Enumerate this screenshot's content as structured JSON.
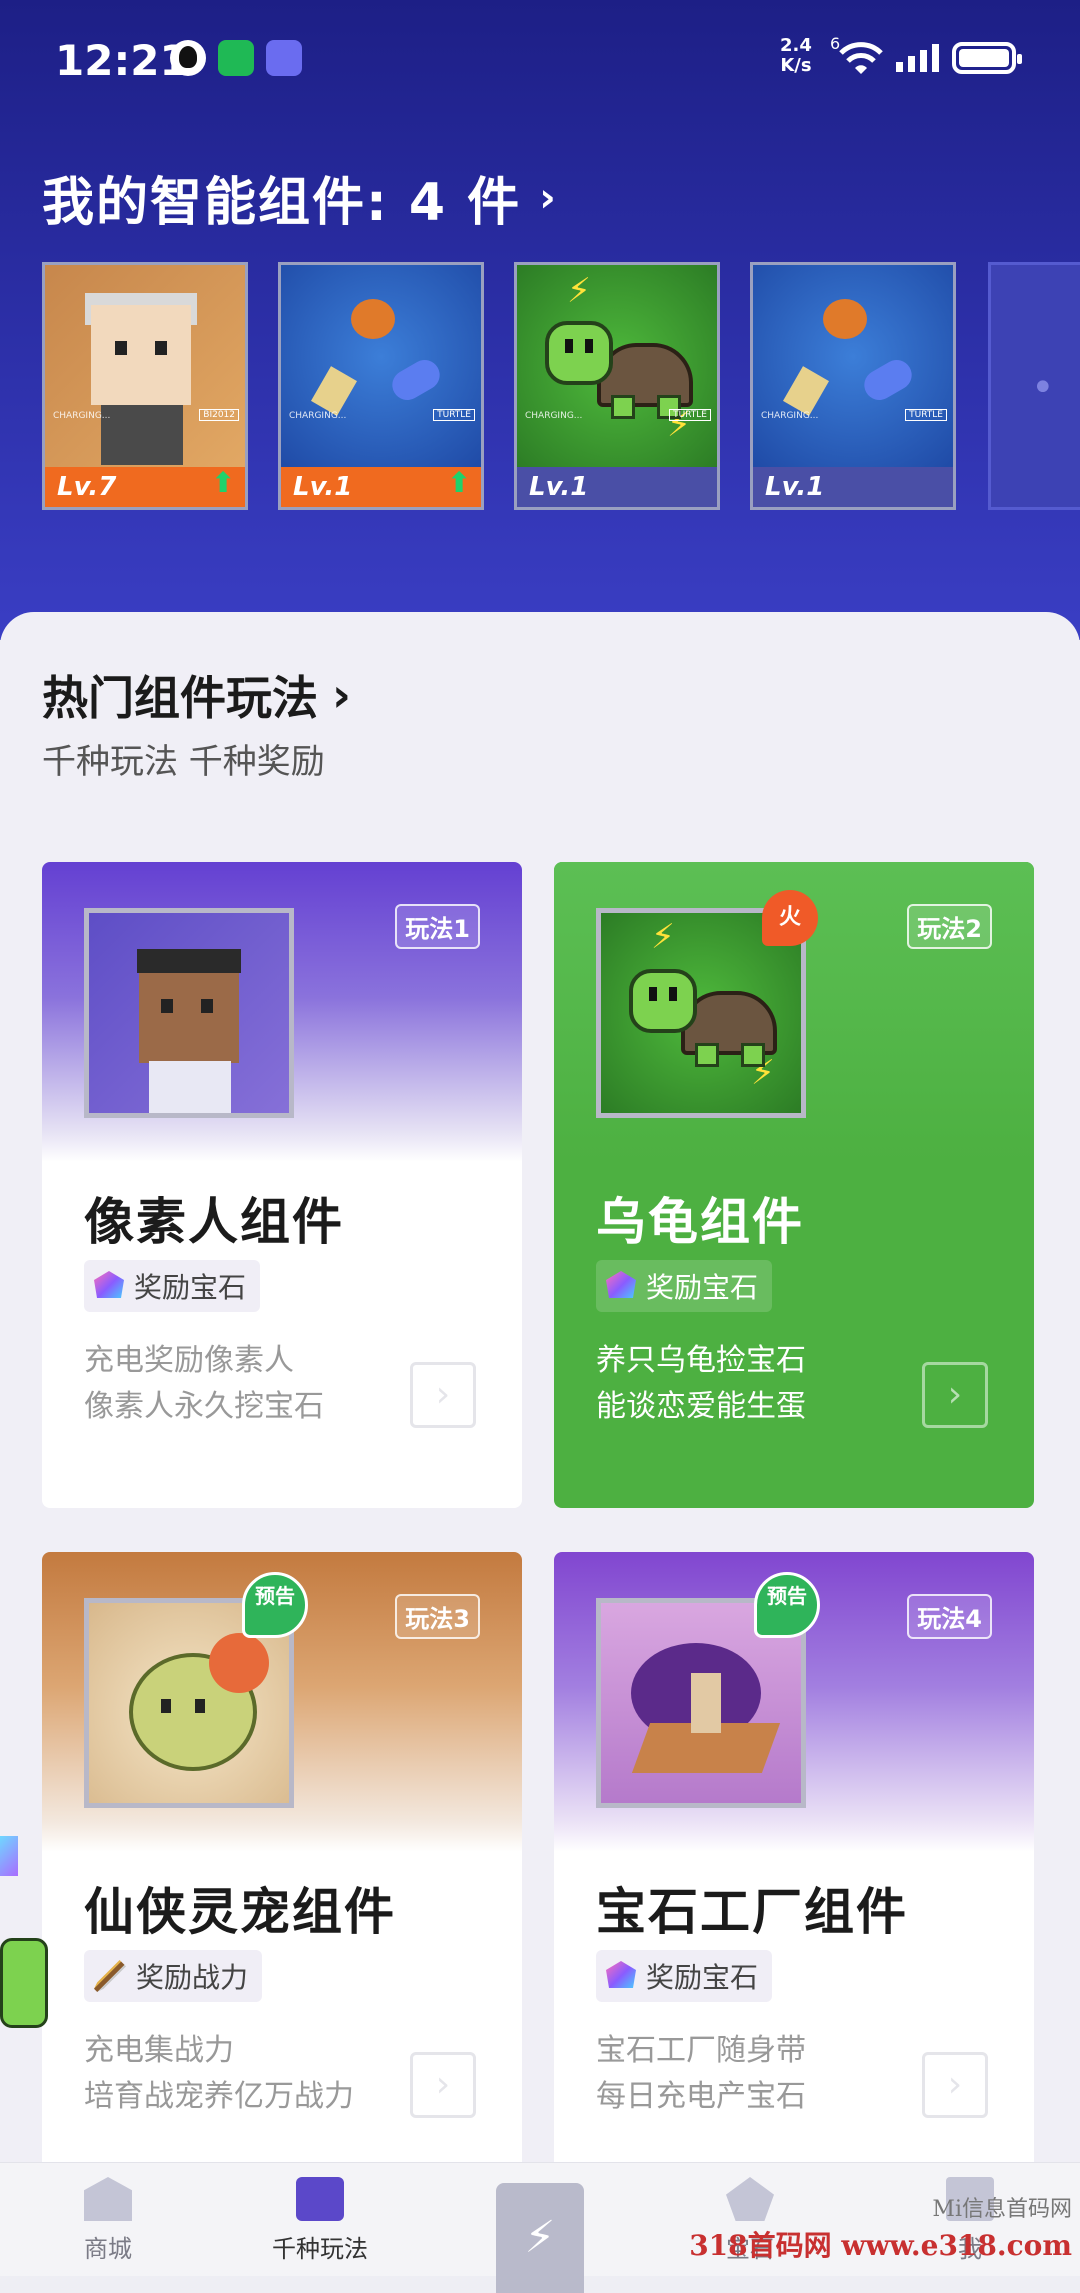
{
  "status_bar": {
    "time": "12:21",
    "net_speed": "2.4",
    "net_unit": "K/s",
    "net_type": "6",
    "icons": [
      "qq-icon",
      "wechat-icon",
      "game-app-icon",
      "wifi-icon",
      "signal-icon",
      "battery-icon"
    ]
  },
  "my_widgets": {
    "title": "我的智能组件: 4 件",
    "chevron": "›",
    "items": [
      {
        "level": "Lv.7",
        "upgrade": true,
        "tag": "BI2012",
        "charging": "CHARGING..."
      },
      {
        "level": "Lv.1",
        "upgrade": true,
        "tag": "TURTLE",
        "charging": "CHARGING..."
      },
      {
        "level": "Lv.1",
        "upgrade": false,
        "tag": "TURTLE",
        "charging": "CHARGING..."
      },
      {
        "level": "Lv.1",
        "upgrade": false,
        "tag": "TURTLE",
        "charging": "CHARGING..."
      }
    ]
  },
  "hot": {
    "title": "热门组件玩法",
    "chevron": "›",
    "subtitle": "千种玩法 千种奖励"
  },
  "cards": [
    {
      "badge": "玩法1",
      "title": "像素人组件",
      "reward": "奖励宝石",
      "desc1": "充电奖励像素人",
      "desc2": "像素人永久挖宝石",
      "go": "›"
    },
    {
      "badge": "玩法2",
      "flag": "火",
      "title": "乌龟组件",
      "reward": "奖励宝石",
      "desc1": "养只乌龟捡宝石",
      "desc2": "能谈恋爱能生蛋",
      "go": "›"
    },
    {
      "badge": "玩法3",
      "flag": "预告",
      "title": "仙侠灵宠组件",
      "reward": "奖励战力",
      "desc1": "充电集战力",
      "desc2": "培育战宠养亿万战力",
      "go": "›"
    },
    {
      "badge": "玩法4",
      "flag": "预告",
      "title": "宝石工厂组件",
      "reward": "奖励宝石",
      "desc1": "宝石工厂随身带",
      "desc2": "每日充电产宝石",
      "go": "›"
    }
  ],
  "nav": {
    "home": "商城",
    "play": "千种玩法",
    "charge": "⚡",
    "shop": "宝石",
    "me": "我"
  },
  "watermark": {
    "line1": "Mi信息首码网",
    "line2": "318首码网 www.e318.com"
  },
  "colors": {
    "header": "#2a2da3",
    "accent_green": "#4db041",
    "accent_orange": "#f06a1f",
    "accent_purple": "#5b48c9"
  }
}
